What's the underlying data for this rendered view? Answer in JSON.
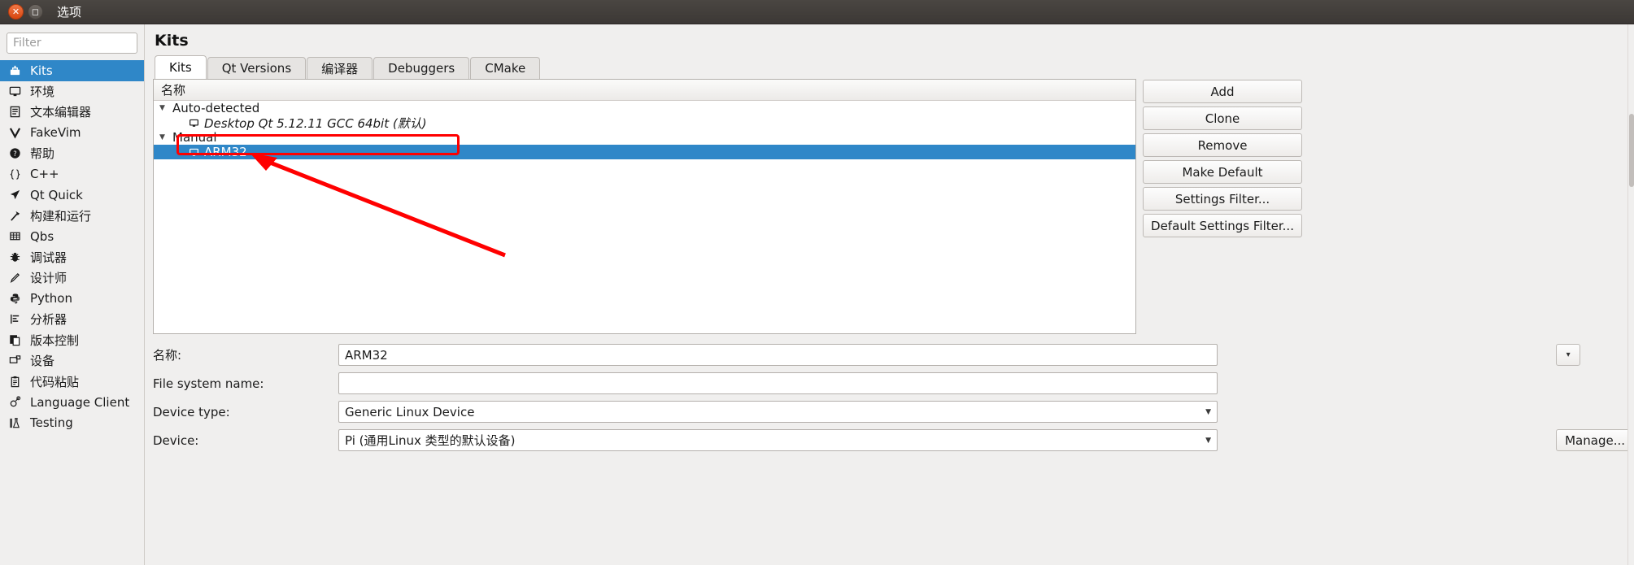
{
  "window": {
    "title": "选项",
    "close_icon": "close-icon",
    "maximize_icon": "maximize-icon"
  },
  "sidebar": {
    "filter": {
      "value": "",
      "placeholder": "Filter"
    },
    "items": [
      {
        "label": "Kits",
        "icon": "kits-icon",
        "selected": true
      },
      {
        "label": "环境",
        "icon": "monitor-icon",
        "selected": false
      },
      {
        "label": "文本编辑器",
        "icon": "text-editor-icon",
        "selected": false
      },
      {
        "label": "FakeVim",
        "icon": "fakevim-icon",
        "selected": false
      },
      {
        "label": "帮助",
        "icon": "help-icon",
        "selected": false
      },
      {
        "label": "C++",
        "icon": "braces-icon",
        "selected": false
      },
      {
        "label": "Qt Quick",
        "icon": "qtquick-icon",
        "selected": false
      },
      {
        "label": "构建和运行",
        "icon": "hammer-icon",
        "selected": false
      },
      {
        "label": "Qbs",
        "icon": "grid-icon",
        "selected": false
      },
      {
        "label": "调试器",
        "icon": "bug-icon",
        "selected": false
      },
      {
        "label": "设计师",
        "icon": "pencil-icon",
        "selected": false
      },
      {
        "label": "Python",
        "icon": "python-icon",
        "selected": false
      },
      {
        "label": "分析器",
        "icon": "analyzer-icon",
        "selected": false
      },
      {
        "label": "版本控制",
        "icon": "version-control-icon",
        "selected": false
      },
      {
        "label": "设备",
        "icon": "device-icon",
        "selected": false
      },
      {
        "label": "代码粘贴",
        "icon": "clipboard-icon",
        "selected": false
      },
      {
        "label": "Language Client",
        "icon": "language-client-icon",
        "selected": false
      },
      {
        "label": "Testing",
        "icon": "testing-icon",
        "selected": false
      }
    ]
  },
  "main": {
    "page_title": "Kits",
    "tabs": [
      {
        "label": "Kits",
        "active": true
      },
      {
        "label": "Qt Versions",
        "active": false
      },
      {
        "label": "编译器",
        "active": false
      },
      {
        "label": "Debuggers",
        "active": false
      },
      {
        "label": "CMake",
        "active": false
      }
    ],
    "tree": {
      "column_header": "名称",
      "groups": [
        {
          "label": "Auto-detected",
          "expanded": true,
          "items": [
            {
              "label": "Desktop Qt 5.12.11 GCC 64bit (默认)",
              "italic": true,
              "selected": false,
              "annotated": true
            }
          ]
        },
        {
          "label": "Manual",
          "expanded": true,
          "items": [
            {
              "label": "ARM32",
              "italic": false,
              "selected": true,
              "annotated": false
            }
          ]
        }
      ]
    },
    "buttons": [
      {
        "label": "Add"
      },
      {
        "label": "Clone"
      },
      {
        "label": "Remove"
      },
      {
        "label": "Make Default"
      },
      {
        "label": "Settings Filter..."
      },
      {
        "label": "Default Settings Filter..."
      }
    ],
    "form": {
      "name": {
        "label": "名称:",
        "value": "ARM32"
      },
      "file_system_name": {
        "label": "File system name:",
        "value": ""
      },
      "device_type": {
        "label": "Device type:",
        "value": "Generic Linux Device"
      },
      "device": {
        "label": "Device:",
        "value": "Pi (通用Linux 类型的默认设备)",
        "manage_label": "Manage..."
      }
    }
  },
  "colors": {
    "selection_blue": "#2f87c8",
    "annotation_red": "#ff0000",
    "titlebar": "#3c3835"
  }
}
